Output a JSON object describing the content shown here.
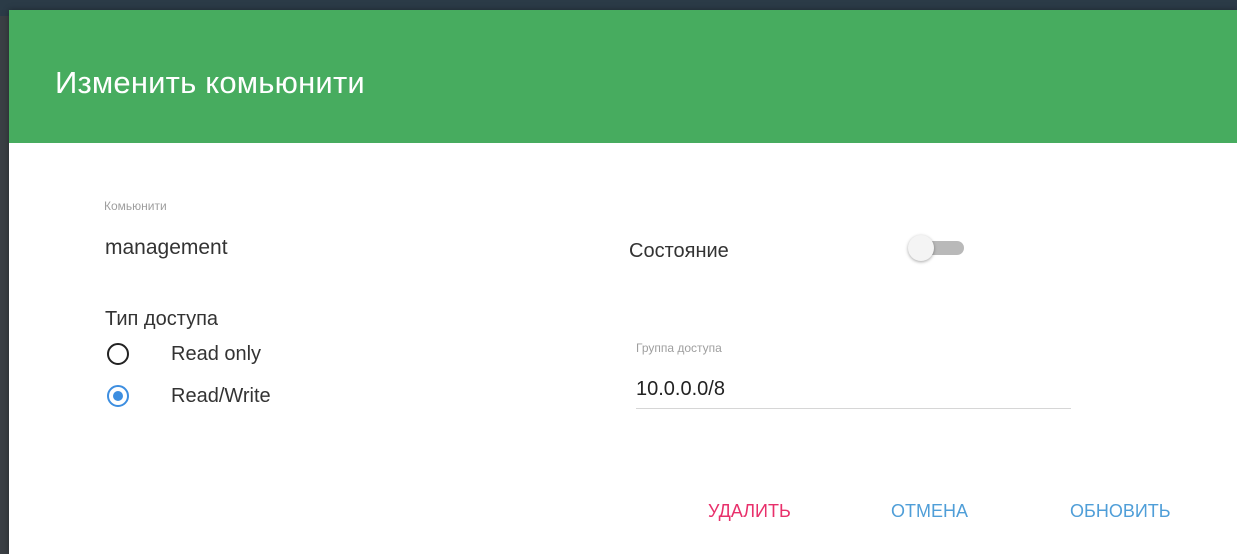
{
  "dialog": {
    "title": "Изменить комьюнити",
    "header_color": "#47ac5f"
  },
  "community": {
    "caption": "Комьюнити",
    "value": "management"
  },
  "access_type": {
    "label": "Тип доступа",
    "options": [
      {
        "label": "Read only",
        "checked": false
      },
      {
        "label": "Read/Write",
        "checked": true
      }
    ]
  },
  "state": {
    "label": "Состояние",
    "enabled": false
  },
  "access_group": {
    "caption": "Группа доступа",
    "value": "10.0.0.0/8"
  },
  "actions": {
    "delete_label": "УДАЛИТЬ",
    "cancel_label": "ОТМЕНА",
    "update_label": "ОБНОВИТЬ",
    "delete_color": "#e8306b",
    "primary_color": "#4f9ed8"
  }
}
